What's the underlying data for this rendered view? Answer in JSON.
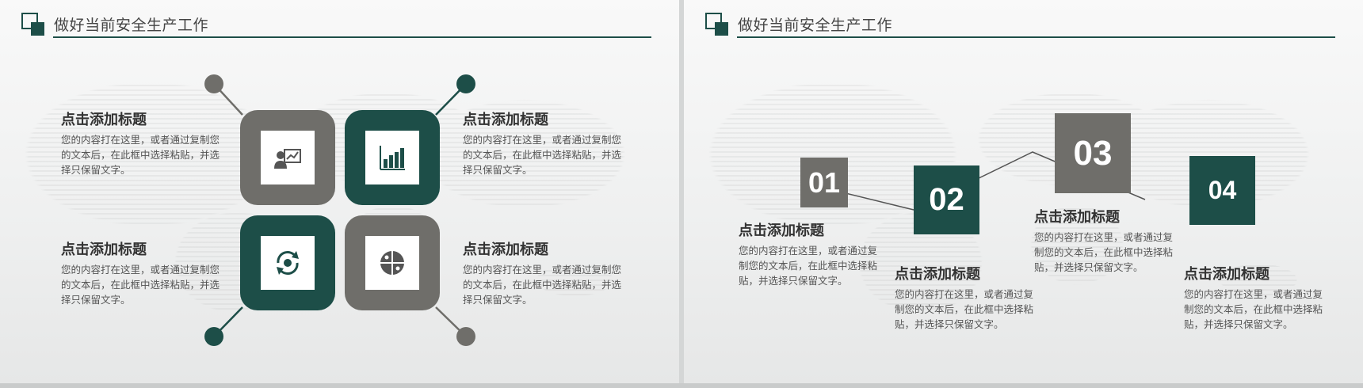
{
  "slides": [
    {
      "title": "做好当前安全生产工作",
      "blocks": [
        {
          "heading": "点击添加标题",
          "body": "您的内容打在这里，或者通过复制您的文本后，在此框中选择粘贴，并选择只保留文字。"
        },
        {
          "heading": "点击添加标题",
          "body": "您的内容打在这里，或者通过复制您的文本后，在此框中选择粘贴，并选择只保留文字。"
        },
        {
          "heading": "点击添加标题",
          "body": "您的内容打在这里，或者通过复制您的文本后，在此框中选择粘贴，并选择只保留文字。"
        },
        {
          "heading": "点击添加标题",
          "body": "您的内容打在这里，或者通过复制您的文本后，在此框中选择粘贴，并选择只保留文字。"
        }
      ],
      "icons": [
        "presentation-icon",
        "bar-chart-icon",
        "cycle-icon",
        "pie-chart-icon"
      ]
    },
    {
      "title": "做好当前安全生产工作",
      "steps": [
        {
          "number": "01",
          "heading": "点击添加标题",
          "body": "您的内容打在这里，或者通过复制您的文本后，在此框中选择粘贴，并选择只保留文字。"
        },
        {
          "number": "02",
          "heading": "点击添加标题",
          "body": "您的内容打在这里，或者通过复制您的文本后，在此框中选择粘贴，并选择只保留文字。"
        },
        {
          "number": "03",
          "heading": "点击添加标题",
          "body": "您的内容打在这里，或者通过复制您的文本后，在此框中选择粘贴，并选择只保留文字。"
        },
        {
          "number": "04",
          "heading": "点击添加标题",
          "body": "您的内容打在这里，或者通过复制您的文本后，在此框中选择粘贴，并选择只保留文字。"
        }
      ]
    }
  ],
  "colors": {
    "accent_green": "#1d4e48",
    "accent_gray": "#6f6e6a",
    "text_dark": "#333333",
    "text_body": "#555555"
  }
}
